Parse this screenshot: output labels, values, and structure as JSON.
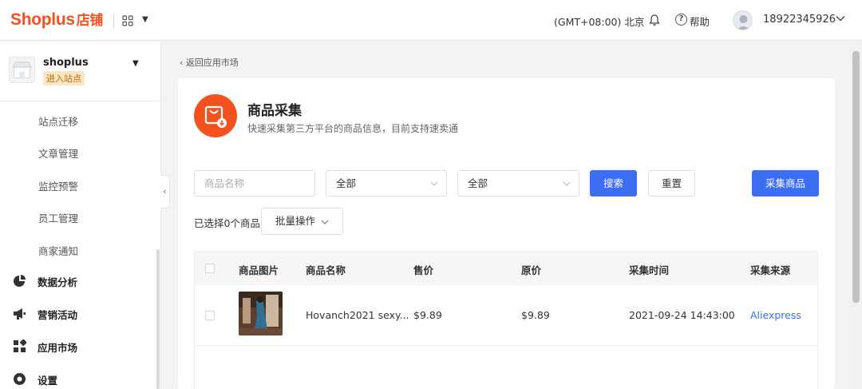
{
  "topbar": {
    "brand": "Shoplus",
    "brand_cn": "店铺",
    "timezone": "(GMT+08:00) 北京",
    "help": "帮助",
    "phone": "18922345926"
  },
  "sidebar": {
    "store_name": "shoplus",
    "store_badge": "进入站点",
    "sub_items": [
      "站点迁移",
      "文章管理",
      "监控预警",
      "员工管理",
      "商家通知"
    ],
    "main_items": [
      {
        "label": "数据分析",
        "icon": "pie-chart-icon"
      },
      {
        "label": "营销活动",
        "icon": "megaphone-icon"
      },
      {
        "label": "应用市场",
        "icon": "app-grid-icon"
      },
      {
        "label": "设置",
        "icon": "settings-icon"
      }
    ]
  },
  "main": {
    "back_label": "返回应用市场",
    "title": "商品采集",
    "description": "快速采集第三方平台的商品信息，目前支持速卖通",
    "filters": {
      "name_placeholder": "商品名称",
      "select1": "全部",
      "select2": "全部",
      "search": "搜索",
      "reset": "重置",
      "collect": "采集商品"
    },
    "selected_count": "已选择0个商品",
    "batch": "批量操作",
    "table": {
      "headers": [
        "商品图片",
        "商品名称",
        "售价",
        "原价",
        "采集时间",
        "采集来源"
      ],
      "rows": [
        {
          "name": "Hovanch2021 sexy...",
          "price": "$9.89",
          "original_price": "$9.89",
          "time": "2021-09-24 14:43:00",
          "source": "Aliexpress"
        }
      ]
    }
  },
  "colors": {
    "accent": "#3b6ef2",
    "brand": "#f4511e"
  }
}
